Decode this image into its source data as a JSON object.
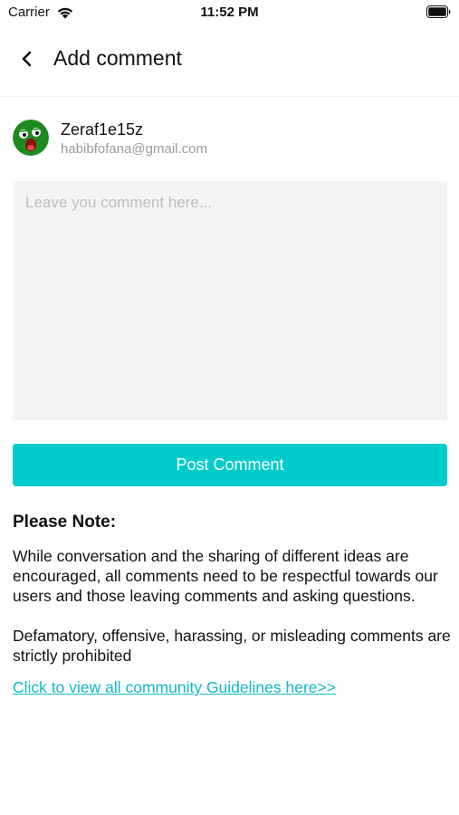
{
  "status_bar": {
    "carrier": "Carrier",
    "time": "11:52 PM",
    "wifi_icon": "wifi-icon",
    "battery_icon": "battery-icon"
  },
  "nav": {
    "back_icon": "chevron-left-icon",
    "title": "Add comment"
  },
  "user": {
    "name": "Zeraf1e15z",
    "email": "habibfofana@gmail.com",
    "avatar_color": "#1f8a1f"
  },
  "comment": {
    "placeholder": "Leave you comment here...",
    "value": ""
  },
  "post_button": {
    "label": "Post Comment",
    "color": "#00cccb"
  },
  "note": {
    "heading": "Please Note:",
    "paragraph1": "While conversation and the sharing of different ideas are encouraged, all comments need to be respectful towards our users and those leaving comments and asking questions.",
    "paragraph2": "Defamatory, offensive, harassing, or misleading comments are strictly prohibited",
    "link_text": "Click to view all community Guidelines here>>",
    "link_color": "#12b9c8"
  }
}
